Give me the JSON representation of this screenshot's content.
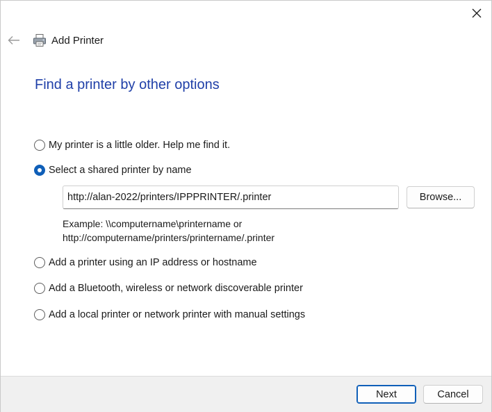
{
  "window": {
    "title": "Add Printer",
    "close_icon": "close-icon",
    "back_icon": "back-arrow-icon",
    "title_icon": "printer-icon"
  },
  "heading": "Find a printer by other options",
  "options": [
    {
      "label": "My printer is a little older. Help me find it.",
      "checked": false
    },
    {
      "label": "Select a shared printer by name",
      "checked": true
    },
    {
      "label": "Add a printer using an IP address or hostname",
      "checked": false
    },
    {
      "label": "Add a Bluetooth, wireless or network discoverable printer",
      "checked": false
    },
    {
      "label": "Add a local printer or network printer with manual settings",
      "checked": false
    }
  ],
  "shared_printer": {
    "value": "http://alan-2022/printers/IPPPRINTER/.printer",
    "browse_label": "Browse...",
    "example_line1": "Example: \\\\computername\\printername or",
    "example_line2": "http://computername/printers/printername/.printer"
  },
  "footer": {
    "next_label": "Next",
    "cancel_label": "Cancel"
  },
  "colors": {
    "accent": "#0f5fb8",
    "heading": "#1f3fa8",
    "footer_bg": "#f0f0f0"
  }
}
